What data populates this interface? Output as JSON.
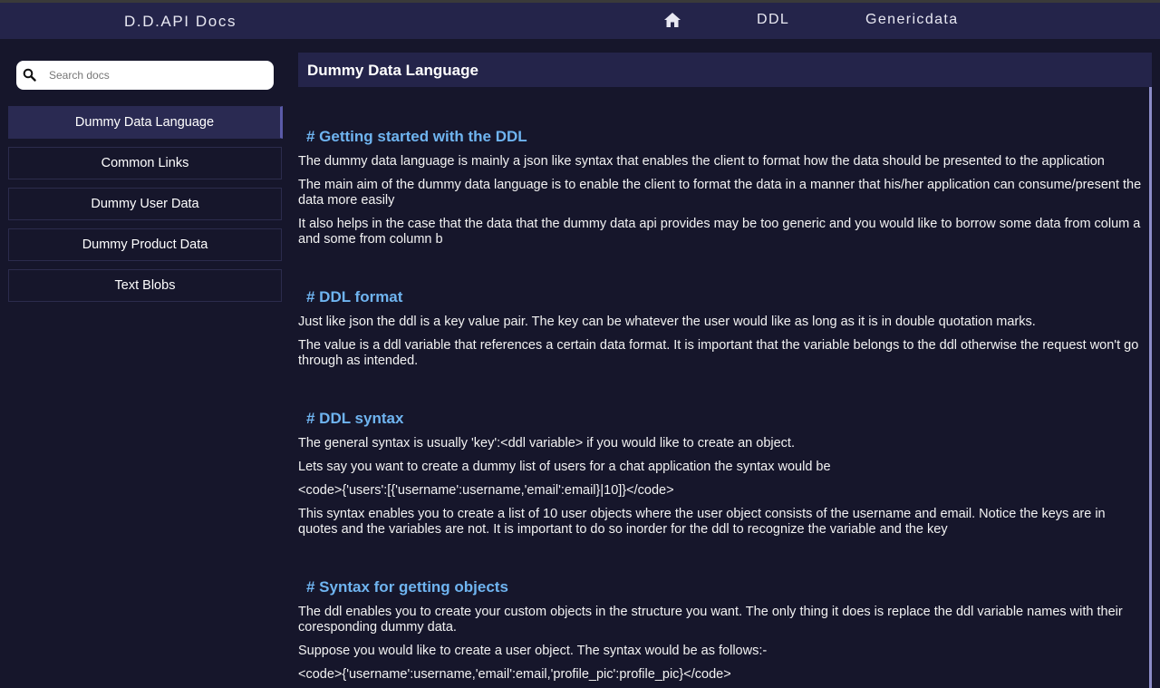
{
  "navbar": {
    "brand": "D.D.API Docs",
    "home_icon": "home-icon",
    "links": [
      "DDL",
      "Genericdata"
    ]
  },
  "sidebar": {
    "search": {
      "placeholder": "Search docs",
      "value": "",
      "icon": "search-icon"
    },
    "items": [
      {
        "label": "Dummy Data Language",
        "active": true
      },
      {
        "label": "Common Links",
        "active": false
      },
      {
        "label": "Dummy User Data",
        "active": false
      },
      {
        "label": "Dummy Product Data",
        "active": false
      },
      {
        "label": "Text Blobs",
        "active": false
      }
    ]
  },
  "main": {
    "title": "Dummy Data Language",
    "sections": [
      {
        "heading": "# Getting started with the DDL",
        "paragraphs": [
          "The dummy data language is mainly a json like syntax that enables the client to format how the data should be presented to the application",
          "The main aim of the dummy data language is to enable the client to format the data in a manner that his/her application can consume/present the data more easily",
          "It also helps in the case that the data that the dummy data api provides may be too generic and you would like to borrow some data from colum a and some from column b"
        ]
      },
      {
        "heading": "# DDL format",
        "paragraphs": [
          "Just like json the ddl is a key value pair. The key can be whatever the user would like as long as it is in double quotation marks.",
          "The value is a ddl variable that references a certain data format. It is important that the variable belongs to the ddl otherwise the request won't go through as intended."
        ]
      },
      {
        "heading": "# DDL syntax",
        "paragraphs": [
          "The general syntax is usually 'key':<ddl variable> if you would like to create an object.",
          "Lets say you want to create a dummy list of users for a chat application the syntax would be",
          "<code>{'users':[{'username':username,'email':email}|10]}</code>",
          "This syntax enables you to create a list of 10 user objects where the user object consists of the username and email. Notice the keys are in quotes and the variables are not. It is important to do so inorder for the ddl to recognize the variable and the key"
        ]
      },
      {
        "heading": "# Syntax for getting objects",
        "paragraphs": [
          "The ddl enables you to create your custom objects in the structure you want. The only thing it does is replace the ddl variable names with their coresponding dummy data.",
          "Suppose you would like to create a user object. The syntax would be as follows:-",
          "<code>{'username':username,'email':email,'profile_pic':profile_pic}</code>"
        ]
      }
    ]
  },
  "colors": {
    "navbar_bg": "#24244a",
    "page_bg": "#16162b",
    "heading_color": "#6fb4f0"
  }
}
